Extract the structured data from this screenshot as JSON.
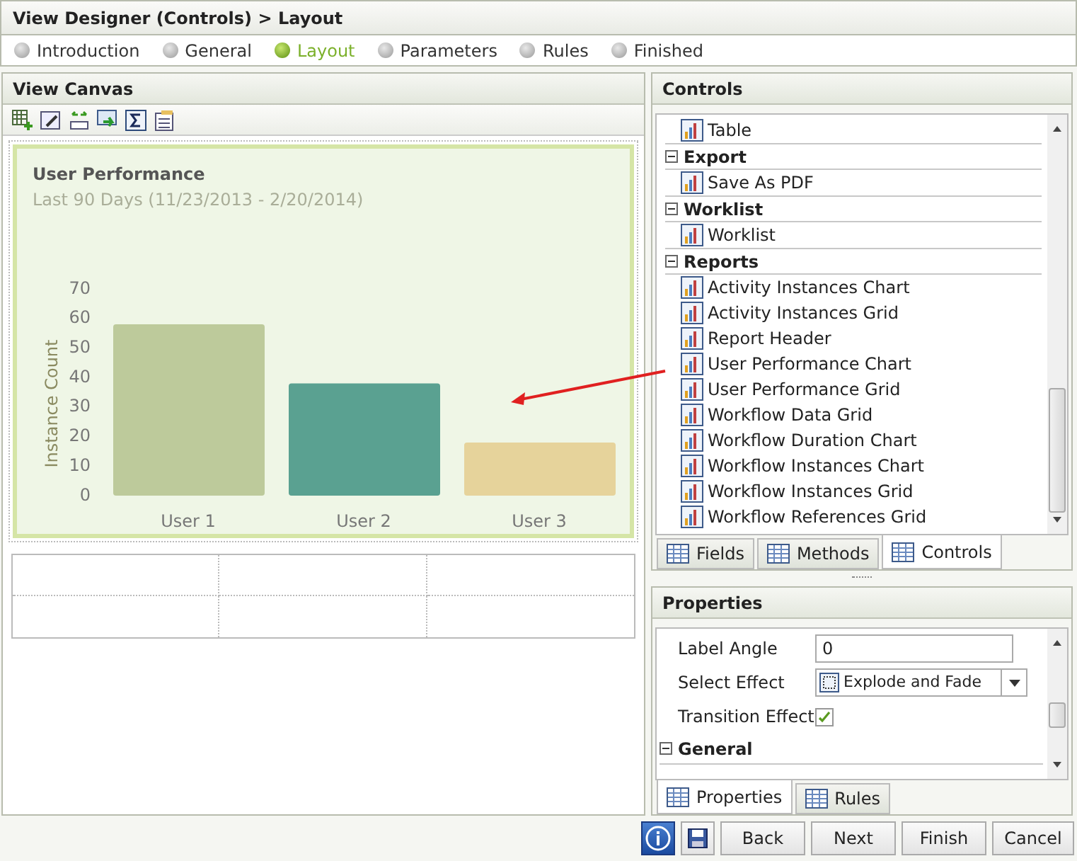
{
  "window": {
    "title": "View Designer (Controls) > Layout"
  },
  "steps": [
    {
      "label": "Introduction",
      "selected": false
    },
    {
      "label": "General",
      "selected": false
    },
    {
      "label": "Layout",
      "selected": true
    },
    {
      "label": "Parameters",
      "selected": false
    },
    {
      "label": "Rules",
      "selected": false
    },
    {
      "label": "Finished",
      "selected": false
    }
  ],
  "canvas": {
    "title": "View Canvas",
    "chart_card": {
      "title": "User Performance",
      "subtitle": "Last 90 Days (11/23/2013 - 2/20/2014)",
      "chart_data": {
        "type": "bar",
        "ylabel": "Instance Count",
        "categories": [
          "User 1",
          "User 2",
          "User 3"
        ],
        "colors": [
          "#bdca9b",
          "#5aa191",
          "#e6d39b"
        ],
        "series": [
          {
            "values": [
              58,
              38,
              18
            ]
          }
        ],
        "ylim": [
          0,
          70
        ],
        "yticks": [
          0,
          10,
          20,
          30,
          40,
          50,
          60,
          70
        ]
      }
    }
  },
  "controls": {
    "title": "Controls",
    "tree": [
      {
        "label": "Table"
      },
      {
        "label": "Export",
        "expanded": true,
        "children": [
          {
            "label": "Save As PDF"
          }
        ]
      },
      {
        "label": "Worklist",
        "expanded": true,
        "children": [
          {
            "label": "Worklist"
          }
        ]
      },
      {
        "label": "Reports",
        "expanded": true,
        "children": [
          {
            "label": "Activity Instances Chart"
          },
          {
            "label": "Activity Instances Grid"
          },
          {
            "label": "Report Header"
          },
          {
            "label": "User Performance Chart"
          },
          {
            "label": "User Performance Grid"
          },
          {
            "label": "Workflow Data Grid"
          },
          {
            "label": "Workflow Duration Chart"
          },
          {
            "label": "Workflow Instances Chart"
          },
          {
            "label": "Workflow Instances Grid"
          },
          {
            "label": "Workflow References Grid"
          }
        ]
      }
    ],
    "tabs": [
      {
        "label": "Fields",
        "selected": false
      },
      {
        "label": "Methods",
        "selected": false
      },
      {
        "label": "Controls",
        "selected": true
      }
    ]
  },
  "properties": {
    "title": "Properties",
    "rows": [
      {
        "kind": "text",
        "label": "Label Angle",
        "value": "0"
      },
      {
        "kind": "select",
        "label": "Select Effect",
        "value": "Explode and Fade"
      },
      {
        "kind": "checkbox",
        "label": "Transition Effect",
        "checked": true
      },
      {
        "kind": "group",
        "label": "General",
        "expanded": true
      }
    ],
    "tabs": [
      {
        "label": "Properties",
        "selected": true
      },
      {
        "label": "Rules",
        "selected": false
      }
    ]
  },
  "buttons": [
    "Back",
    "Next",
    "Finish",
    "Cancel"
  ]
}
